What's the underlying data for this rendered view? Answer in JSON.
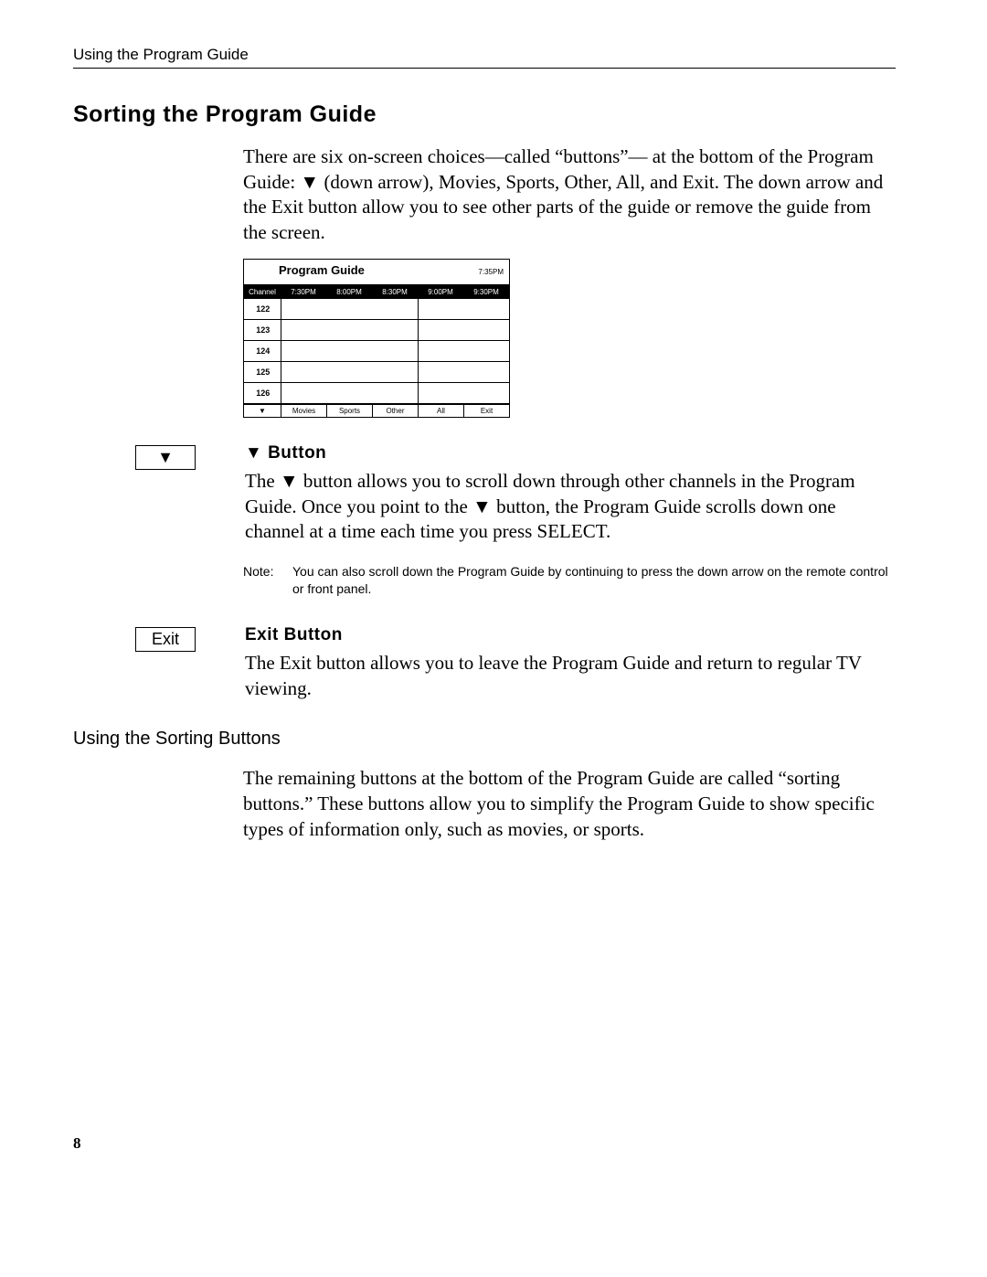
{
  "header": {
    "running": "Using the Program Guide"
  },
  "section": {
    "title": "Sorting the Program Guide",
    "intro": "There are six on-screen choices—called “buttons”— at the bottom of the Program Guide: ▼ (down arrow), Movies, Sports, Other, All, and Exit. The down arrow and the Exit button allow you to see other parts of the guide or remove the guide from the screen."
  },
  "guide": {
    "title": "Program Guide",
    "clock": "7:35PM",
    "colhead": "Channel",
    "timeslots": [
      "7:30PM",
      "8:00PM",
      "8:30PM",
      "9:00PM",
      "9:30PM"
    ],
    "channels": [
      "122",
      "123",
      "124",
      "125",
      "126"
    ],
    "footer": [
      "▼",
      "Movies",
      "Sports",
      "Other",
      "All",
      "Exit"
    ]
  },
  "downbtn": {
    "icon": "▼",
    "heading": "▼ Button",
    "body": "The ▼ button allows you to scroll down through other channels in the Program Guide. Once you point to the ▼ button, the Program Guide scrolls down one channel at a time each time you press SELECT."
  },
  "note": {
    "label": "Note:",
    "text": "You can also scroll down the Program Guide by continuing to press the down arrow on the remote control or front panel."
  },
  "exitbtn": {
    "icon": "Exit",
    "heading": "Exit Button",
    "body": "The Exit button allows you to leave the Program Guide and return to regular TV viewing."
  },
  "sorting": {
    "heading": "Using the Sorting Buttons",
    "body": "The remaining buttons at the bottom of the Program Guide are called “sorting buttons.” These buttons allow you to simplify the Program Guide to show specific types of information only, such as movies, or sports."
  },
  "pagenum": "8"
}
